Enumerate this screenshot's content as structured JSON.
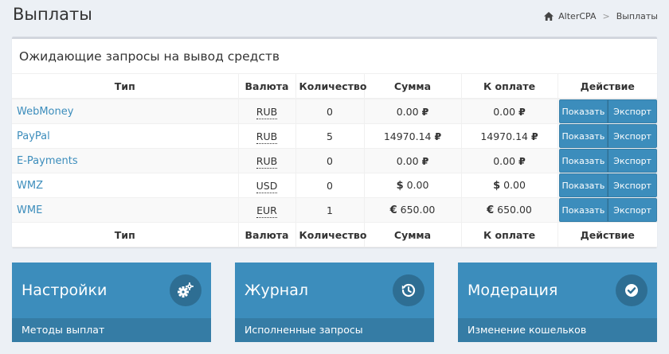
{
  "header": {
    "title": "Выплаты",
    "breadcrumb": {
      "home": "AlterCPA",
      "sep": ">",
      "current": "Выплаты"
    }
  },
  "box": {
    "title": "Ожидающие запросы на вывод средств",
    "columns": [
      "Тип",
      "Валюта",
      "Количество",
      "Сумма",
      "К оплате",
      "Действие"
    ],
    "rows": [
      {
        "type": "WebMoney",
        "currency": "RUB",
        "count": "0",
        "sum": "0.00",
        "sum_sym": "₽",
        "sym_pos": "after",
        "pay": "0.00"
      },
      {
        "type": "PayPal",
        "currency": "RUB",
        "count": "5",
        "sum": "14970.14",
        "sum_sym": "₽",
        "sym_pos": "after",
        "pay": "14970.14"
      },
      {
        "type": "E-Payments",
        "currency": "RUB",
        "count": "0",
        "sum": "0.00",
        "sum_sym": "₽",
        "sym_pos": "after",
        "pay": "0.00"
      },
      {
        "type": "WMZ",
        "currency": "USD",
        "count": "0",
        "sum": "0.00",
        "sum_sym": "$",
        "sym_pos": "before",
        "pay": "0.00"
      },
      {
        "type": "WME",
        "currency": "EUR",
        "count": "1",
        "sum": "650.00",
        "sum_sym": "€",
        "sym_pos": "before",
        "pay": "650.00"
      }
    ],
    "actions": {
      "show": "Показать",
      "export": "Экспорт"
    }
  },
  "tiles": [
    {
      "title": "Настройки",
      "footer": "Методы выплат",
      "icon": "gears-icon"
    },
    {
      "title": "Журнал",
      "footer": "Исполненные запросы",
      "icon": "history-icon"
    },
    {
      "title": "Модерация",
      "footer": "Изменение кошельков",
      "icon": "check-circle-icon"
    }
  ],
  "colors": {
    "primary": "#3c8dbc",
    "primary_dark": "#357ca5",
    "link": "#3c8dbc",
    "background": "#ecf0f5"
  }
}
